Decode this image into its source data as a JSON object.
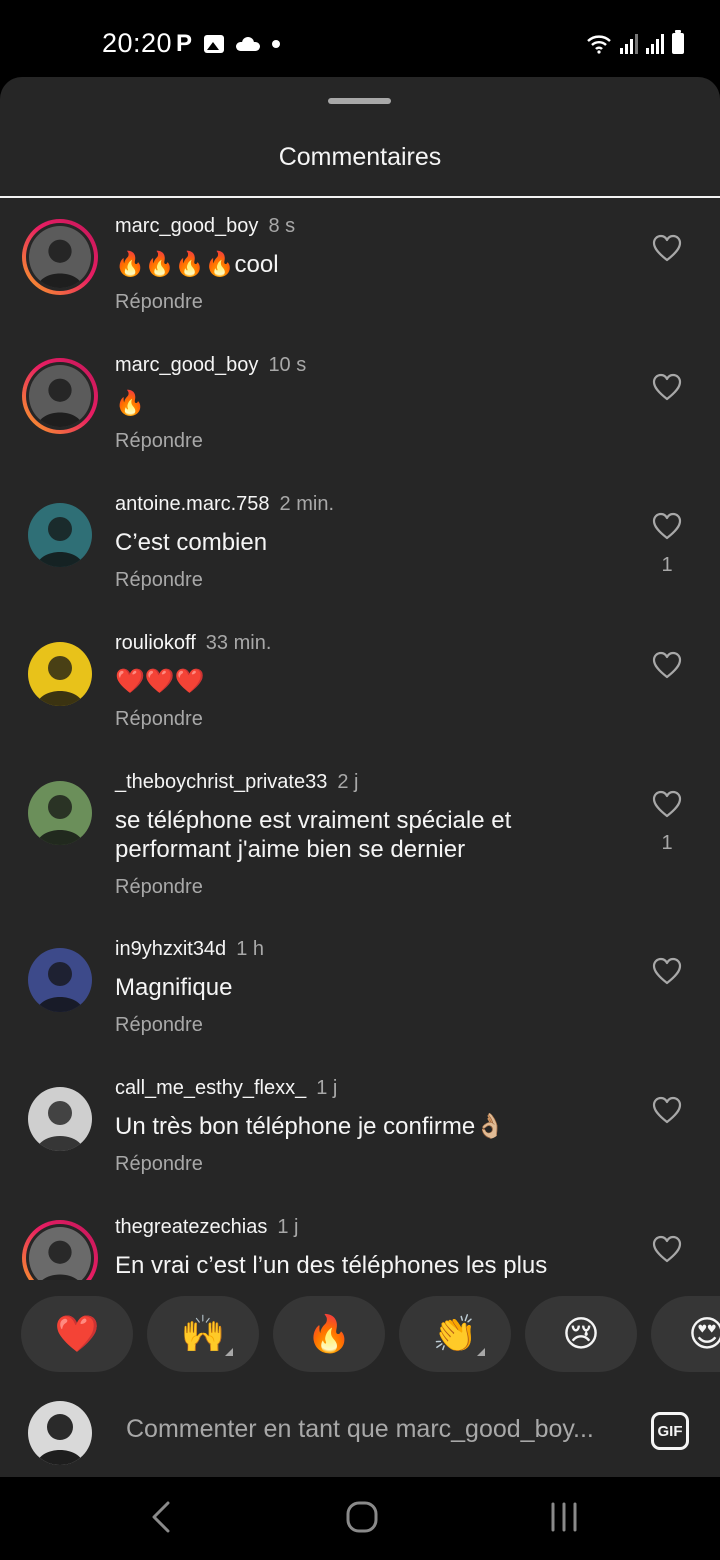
{
  "status_bar": {
    "time": "20:20"
  },
  "sheet": {
    "title": "Commentaires"
  },
  "comments": [
    {
      "user": "marc_good_boy",
      "time": "8 s",
      "text": "🔥🔥🔥🔥cool",
      "reply": "Répondre",
      "likes": "",
      "story_ring": true,
      "avatar_tone": "#5b5b5b"
    },
    {
      "user": "marc_good_boy",
      "time": "10 s",
      "text": "🔥",
      "reply": "Répondre",
      "likes": "",
      "story_ring": true,
      "avatar_tone": "#5b5b5b"
    },
    {
      "user": "antoine.marc.758",
      "time": "2 min.",
      "text": "C’est combien",
      "reply": "Répondre",
      "likes": "1",
      "story_ring": false,
      "avatar_tone": "#2f6f76"
    },
    {
      "user": "rouliokoff",
      "time": "33 min.",
      "text": "❤️❤️❤️",
      "reply": "Répondre",
      "likes": "",
      "story_ring": false,
      "avatar_tone": "#e8c21a"
    },
    {
      "user": "_theboychrist_private33",
      "time": "2 j",
      "text": "se téléphone est vraiment spéciale et performant j'aime bien se dernier",
      "reply": "Répondre",
      "likes": "1",
      "story_ring": false,
      "avatar_tone": "#6b8f5a"
    },
    {
      "user": "in9yhzxit34d",
      "time": "1 h",
      "text": "Magnifique",
      "reply": "Répondre",
      "likes": "",
      "story_ring": false,
      "avatar_tone": "#3d4a8a"
    },
    {
      "user": "call_me_esthy_flexx_",
      "time": "1 j",
      "text": "Un très bon téléphone je confirme👌🏼",
      "reply": "Répondre",
      "likes": "",
      "story_ring": false,
      "avatar_tone": "#cfcfcf"
    },
    {
      "user": "thegreatezechias",
      "time": "1 j",
      "text": "En vrai c’est l’un des téléphones les plus",
      "reply": "",
      "likes": "",
      "story_ring": true,
      "avatar_tone": "#6a6a6a"
    }
  ],
  "reactions": [
    {
      "emoji": "❤️",
      "has_variants": false
    },
    {
      "emoji": "🙌",
      "has_variants": true
    },
    {
      "emoji": "🔥",
      "has_variants": false
    },
    {
      "emoji": "👏",
      "has_variants": true
    },
    {
      "emoji": "😢",
      "has_variants": false
    },
    {
      "emoji": "😍",
      "has_variants": false
    }
  ],
  "composer": {
    "placeholder": "Commenter en tant que marc_good_boy...",
    "gif_label": "GIF"
  },
  "colors": {
    "sheet_bg": "#262626",
    "secondary_text": "#a8a8a8",
    "primary_text": "#f5f5f5",
    "story_ring_start": "#f9a825",
    "story_ring_end": "#c2185b"
  },
  "icons": {
    "like": "heart-outline-icon",
    "nav_back": "chevron-left-icon",
    "nav_home": "rounded-square-icon",
    "nav_recents": "three-bars-icon"
  }
}
